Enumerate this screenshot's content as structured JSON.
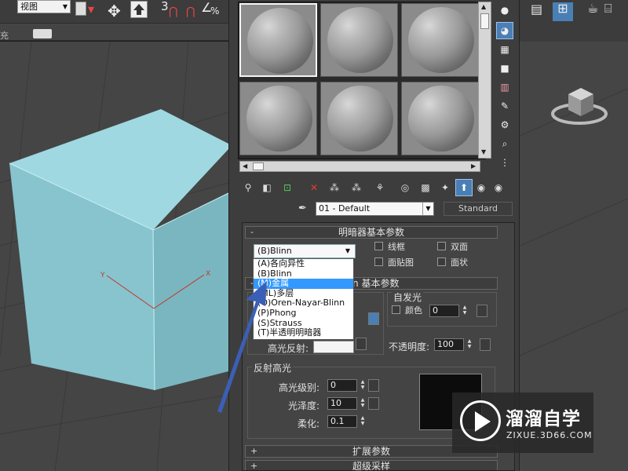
{
  "toolbar": {
    "viewport_dropdown": "视图",
    "snap_label": "3",
    "left_text": "充"
  },
  "material_editor": {
    "slots_count": 6,
    "selected_slot": 1,
    "material_name": "01 - Default",
    "material_type": "Standard",
    "rollouts": {
      "shader_basic": "明暗器基本参数",
      "blinn_basic": "基本参数",
      "blinn_basic_prefix": "n",
      "extended": "扩展参数",
      "supersampling": "超级采样"
    },
    "shader_select": {
      "value": "(B)Blinn",
      "options": [
        "(A)各向异性",
        "(B)Blinn",
        "(M)金属",
        "(ML)多层",
        "(O)Oren-Nayar-Blinn",
        "(P)Phong",
        "(S)Strauss",
        "(T)半透明明暗器"
      ],
      "highlighted_index": 2
    },
    "checkboxes": {
      "wire": "线框",
      "two_sided": "双面",
      "face_map": "面贴图",
      "faceted": "面状"
    },
    "self_illum": {
      "group_label": "自发光",
      "color_label": "颜色",
      "value": "0"
    },
    "specular_color_label": "高光反射:",
    "opacity": {
      "label": "不透明度:",
      "value": "100"
    },
    "specular_highlights": {
      "group_label": "反射高光",
      "level_label": "高光级别:",
      "level_value": "0",
      "gloss_label": "光泽度:",
      "gloss_value": "10",
      "soften_label": "柔化:",
      "soften_value": "0.1"
    }
  },
  "watermark": {
    "title": "溜溜自学",
    "url": "ZIXUE.3D66.COM"
  },
  "colors": {
    "cube_light": "#8fcdd6",
    "cube_dark": "#6aa6b0",
    "highlight": "#3399ff",
    "annotation": "#3b5fb5"
  }
}
